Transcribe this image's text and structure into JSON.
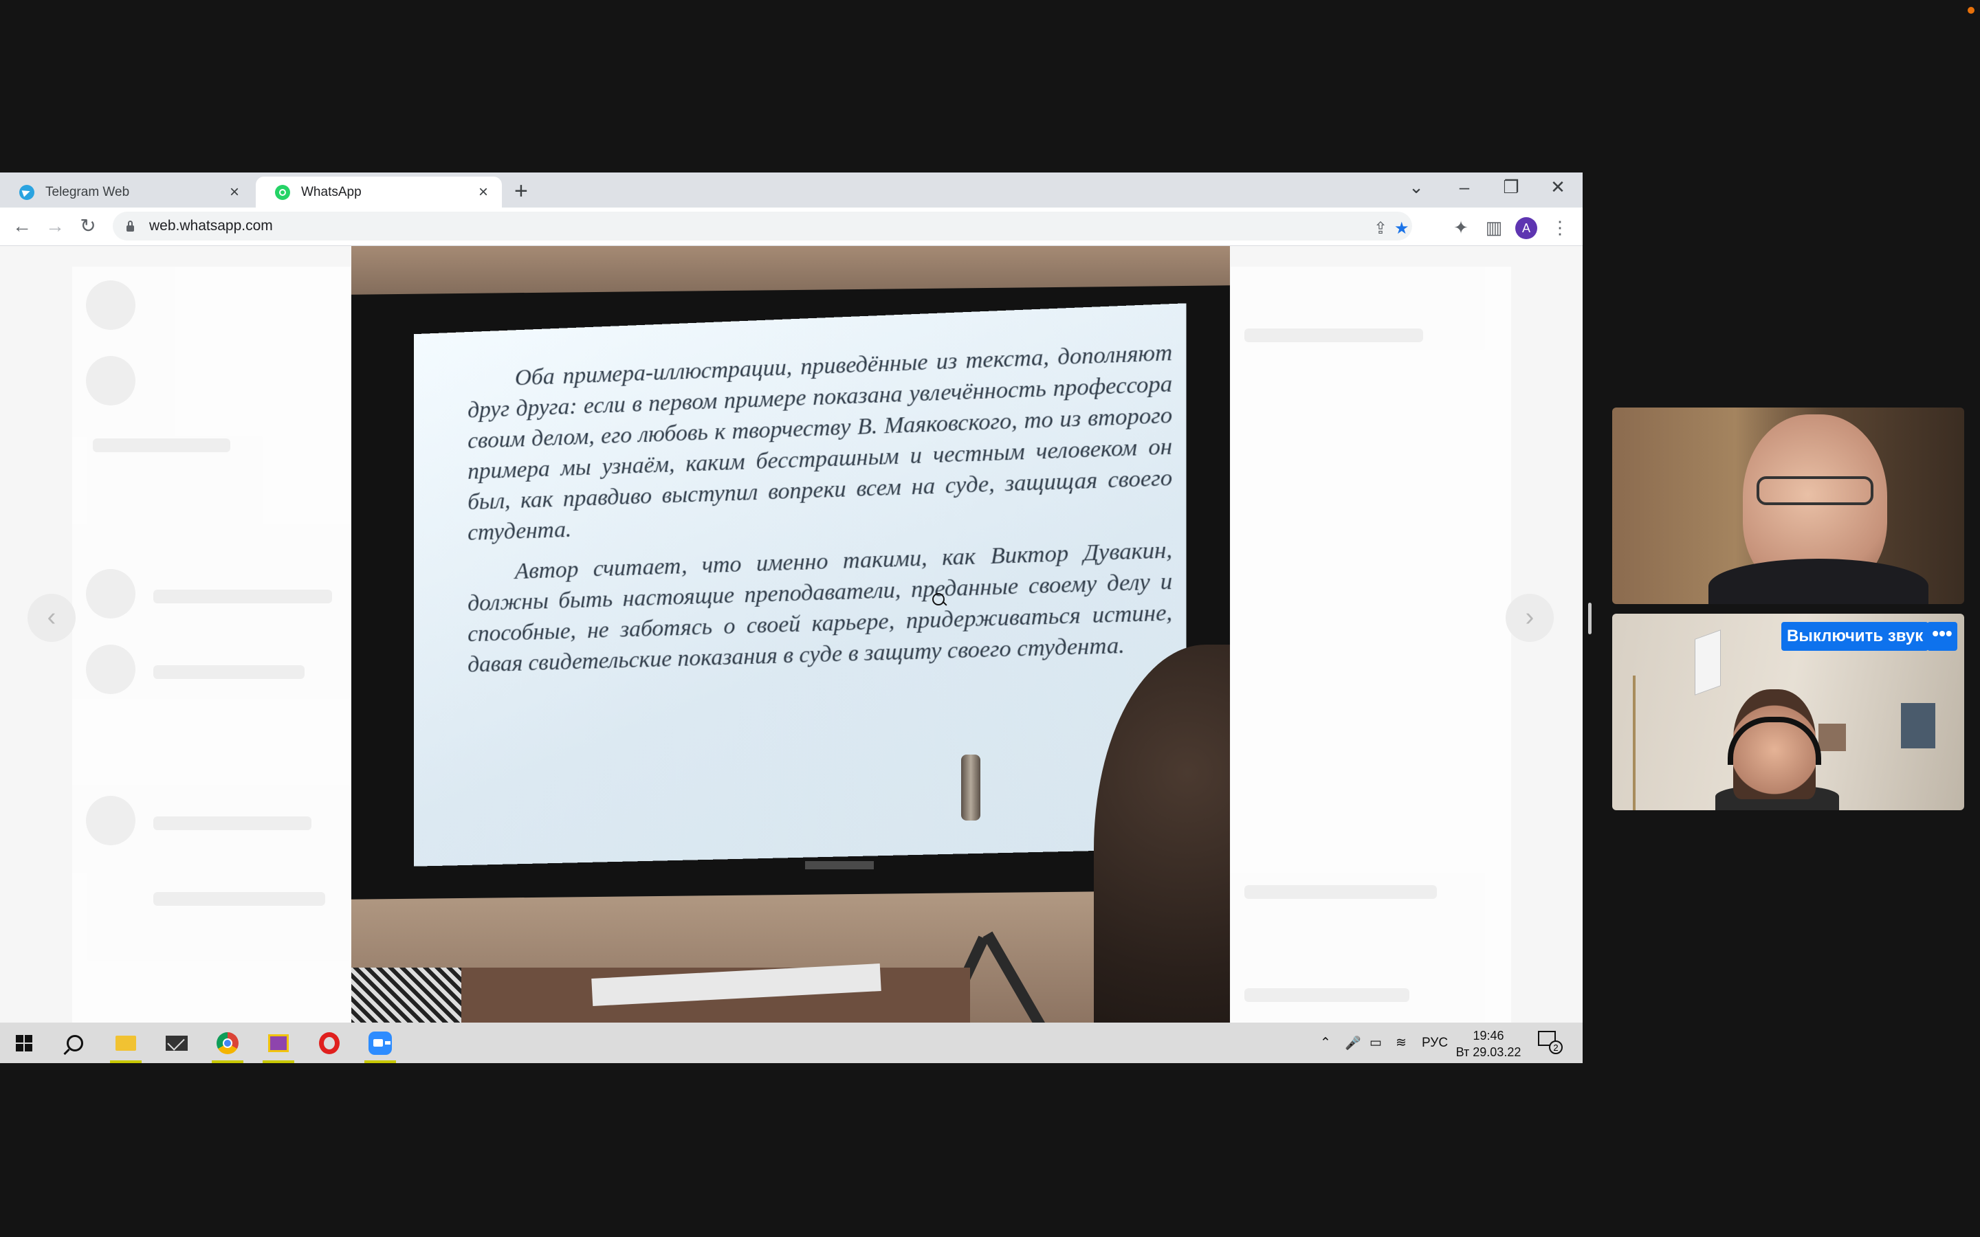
{
  "browser": {
    "tabs": [
      {
        "title": "Telegram Web",
        "icon": "telegram-icon"
      },
      {
        "title": "WhatsApp",
        "icon": "whatsapp-icon",
        "active": true
      }
    ],
    "url": "web.whatsapp.com",
    "profile_initial": "A"
  },
  "slide": {
    "paragraphs": [
      "Оба примера-иллюстрации, приведённые из текста, дополняют друг друга: если в первом примере показана увлечённость профессора своим делом, его любовь к творчеству В. Маяковского, то из второго примера мы узнаём, каким бесстрашным и честным человеком он был, как правдиво выступил вопреки всем на суде, защищая своего студента.",
      "Автор считает, что именно такими, как Виктор Дувакин, должны быть настоящие преподаватели, преданные своему делу и способные, не заботясь о своей карьере, придерживаться истине, давая свидетельские показания в суде в защиту своего студента."
    ]
  },
  "taskbar": {
    "apps": [
      "windows-start-icon",
      "search-icon",
      "file-explorer-icon",
      "mail-icon",
      "chrome-icon",
      "winrar-icon",
      "opera-icon",
      "zoom-icon"
    ],
    "language": "РУС",
    "time": "19:46",
    "date": "Вт 29.03.22",
    "notification_count": "2"
  },
  "participants": {
    "mute_label": "Выключить звук",
    "more_label": "•••"
  },
  "colors": {
    "accent": "#0e72ed",
    "taskbar": "#dcdcdc",
    "background": "#141414"
  }
}
